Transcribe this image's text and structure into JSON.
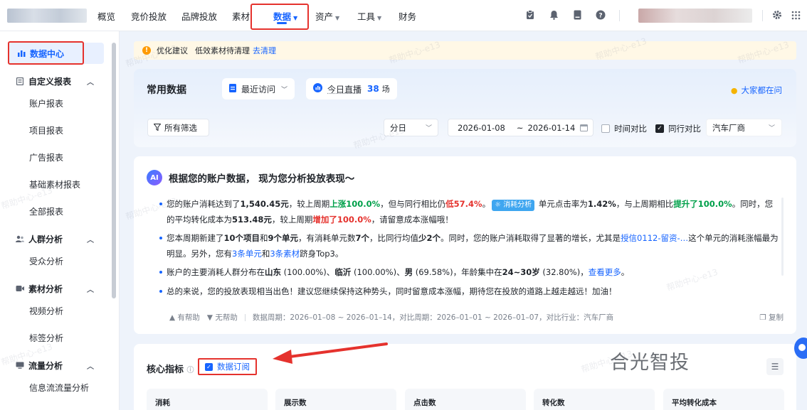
{
  "nav": {
    "items": [
      "概览",
      "竞价投放",
      "品牌投放",
      "素材",
      "数据",
      "资产",
      "工具",
      "财务"
    ],
    "active": "数据"
  },
  "sidebar": {
    "main": "数据中心",
    "groups": [
      {
        "label": "自定义报表",
        "items": [
          "账户报表",
          "项目报表",
          "广告报表",
          "基础素材报表",
          "全部报表"
        ]
      },
      {
        "label": "人群分析",
        "items": [
          "受众分析"
        ]
      },
      {
        "label": "素材分析",
        "items": [
          "视频分析",
          "标签分析"
        ]
      },
      {
        "label": "流量分析",
        "items": [
          "信息流流量分析"
        ]
      }
    ]
  },
  "notice": {
    "title": "优化建议",
    "text": "低效素材待清理",
    "link": "去清理"
  },
  "common": {
    "title": "常用数据",
    "recent": "最近访问",
    "live_label": "今日直播",
    "live_count": "38",
    "live_unit": "场",
    "hint": "大家都在问"
  },
  "filters": {
    "all": "所有筛选",
    "granularity": "分日",
    "date_start": "2026-01-08",
    "date_sep": "~",
    "date_end": "2026-01-14",
    "compare_time": "时间对比",
    "compare_peer": "同行对比",
    "industry": "汽车厂商"
  },
  "ai": {
    "badge": "AI",
    "heading": "根据您的账户数据， 现为您分析投放表现～",
    "p1": {
      "a": "您的账户消耗达到了",
      "spend": "1,540.45元",
      "b": "，较上周期",
      "up1": "上涨100.0%",
      "c": "，但与同行相比仍",
      "low": "低57.4%",
      "d": "。",
      "tag": "消耗分析",
      "e": "单元点击率为",
      "ctr": "1.42%",
      "f": "，与上周期相比",
      "up2": "提升了100.0%",
      "g": "。同时，您的平均转化成本为",
      "cost": "513.48元",
      "h": "，较上周期",
      "up3": "增加了100.0%",
      "i": "，请留意成本涨幅哦！"
    },
    "p2": {
      "a": "您本周期新建了",
      "n1": "10个项目",
      "b": "和",
      "n2": "9个单元",
      "c": "，有消耗单元数",
      "n3": "7个",
      "d": "，比同行均值",
      "n4": "少2个",
      "e": "。同时，您的账户消耗取得了显著的增长，尤其是",
      "unit": "授信0112-留资-…",
      "f": "这个单元的消耗涨幅最为明显。另外，您有",
      "l1": "3条单元",
      "g": "和",
      "l2": "3条素材",
      "h": "跻身Top3。"
    },
    "p3": {
      "a": "账户的主要消耗人群分布在",
      "c1": "山东",
      "c1v": " (100.00%)、",
      "c2": "临沂",
      "c2v": " (100.00%)、",
      "c3": "男",
      "c3v": " (69.58%)，年龄集中在",
      "age": "24~30岁",
      "agev": " (32.80%)，",
      "more": "查看更多",
      "end": "。"
    },
    "p4": "总的来说，您的投放表现相当出色！建议您继续保持这种势头，同时留意成本涨幅，期待您在投放的道路上越走越远！加油！",
    "foot_helpful": "有帮助",
    "foot_unhelpful": "无帮助",
    "foot_period": "数据周期：2026–01–08 ~ 2026–01–14，对比周期：2026–01–01 ~ 2026–01–07，对比行业：汽车厂商",
    "copy": "复制"
  },
  "core": {
    "title": "核心指标",
    "subscribe": "数据订阅",
    "metrics": [
      "消耗",
      "展示数",
      "点击数",
      "转化数",
      "平均转化成本"
    ]
  },
  "watermark": {
    "big": "合光智投",
    "small": "帮助中心-e13"
  },
  "colors": {
    "accent": "#1664ff",
    "highlight_red": "#e5322d",
    "positive_green": "#00a04a"
  }
}
